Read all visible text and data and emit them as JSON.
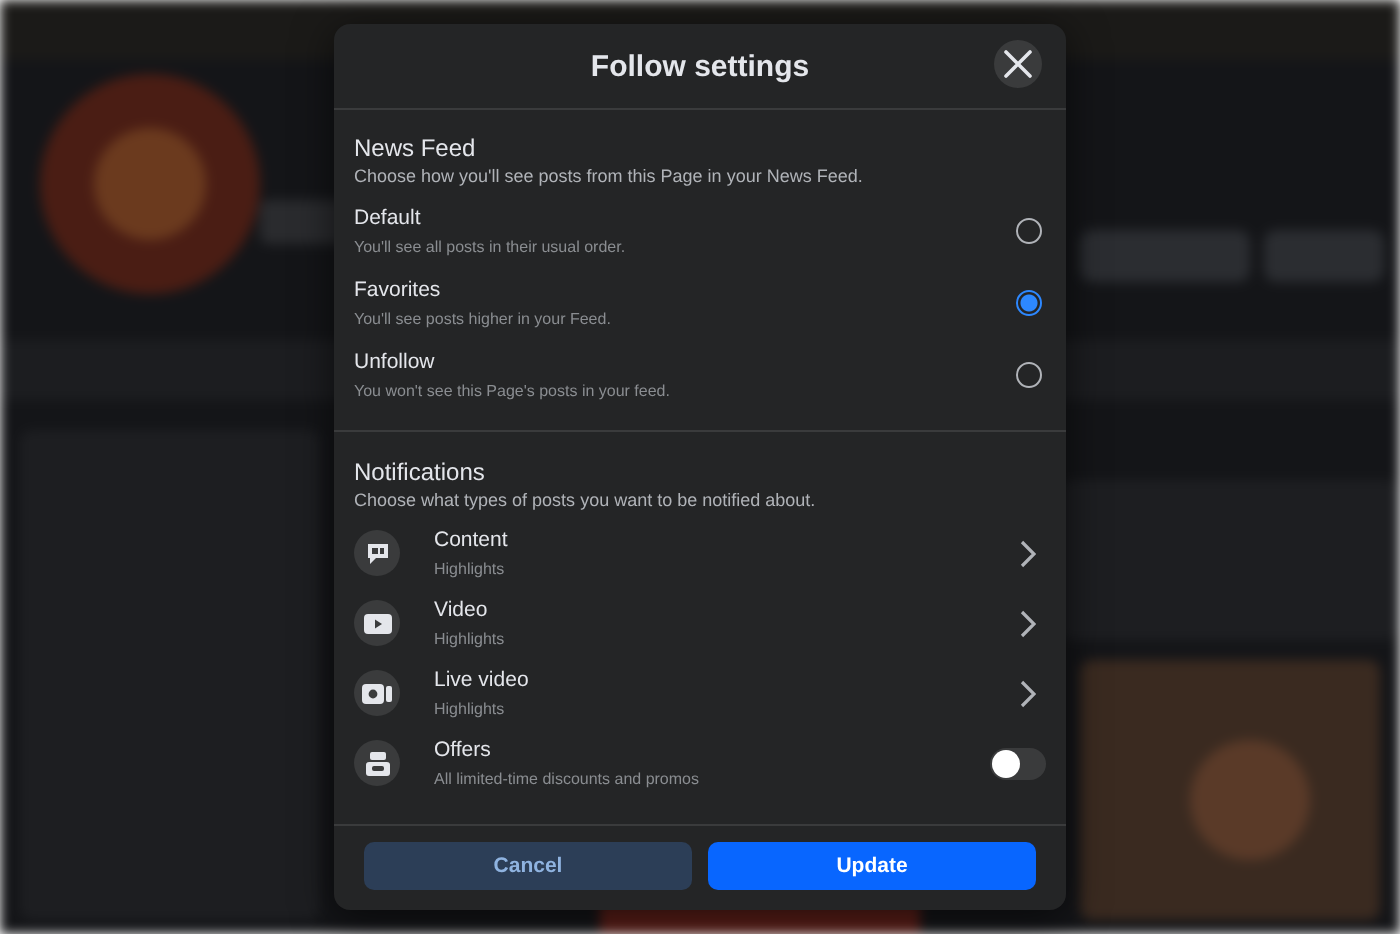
{
  "dialog": {
    "title": "Follow settings"
  },
  "news_feed": {
    "heading": "News Feed",
    "description": "Choose how you'll see posts from this Page in your News Feed.",
    "options": [
      {
        "label": "Default",
        "description": "You'll see all posts in their usual order.",
        "selected": false
      },
      {
        "label": "Favorites",
        "description": "You'll see posts higher in your Feed.",
        "selected": true
      },
      {
        "label": "Unfollow",
        "description": "You won't see this Page's posts in your feed.",
        "selected": false
      }
    ]
  },
  "notifications": {
    "heading": "Notifications",
    "description": "Choose what types of posts you want to be notified about.",
    "items": [
      {
        "kind": "chevron",
        "label": "Content",
        "description": "Highlights"
      },
      {
        "kind": "chevron",
        "label": "Video",
        "description": "Highlights"
      },
      {
        "kind": "chevron",
        "label": "Live video",
        "description": "Highlights"
      },
      {
        "kind": "toggle",
        "label": "Offers",
        "description": "All limited-time discounts and promos",
        "on": false
      }
    ]
  },
  "buttons": {
    "cancel": "Cancel",
    "update": "Update"
  }
}
